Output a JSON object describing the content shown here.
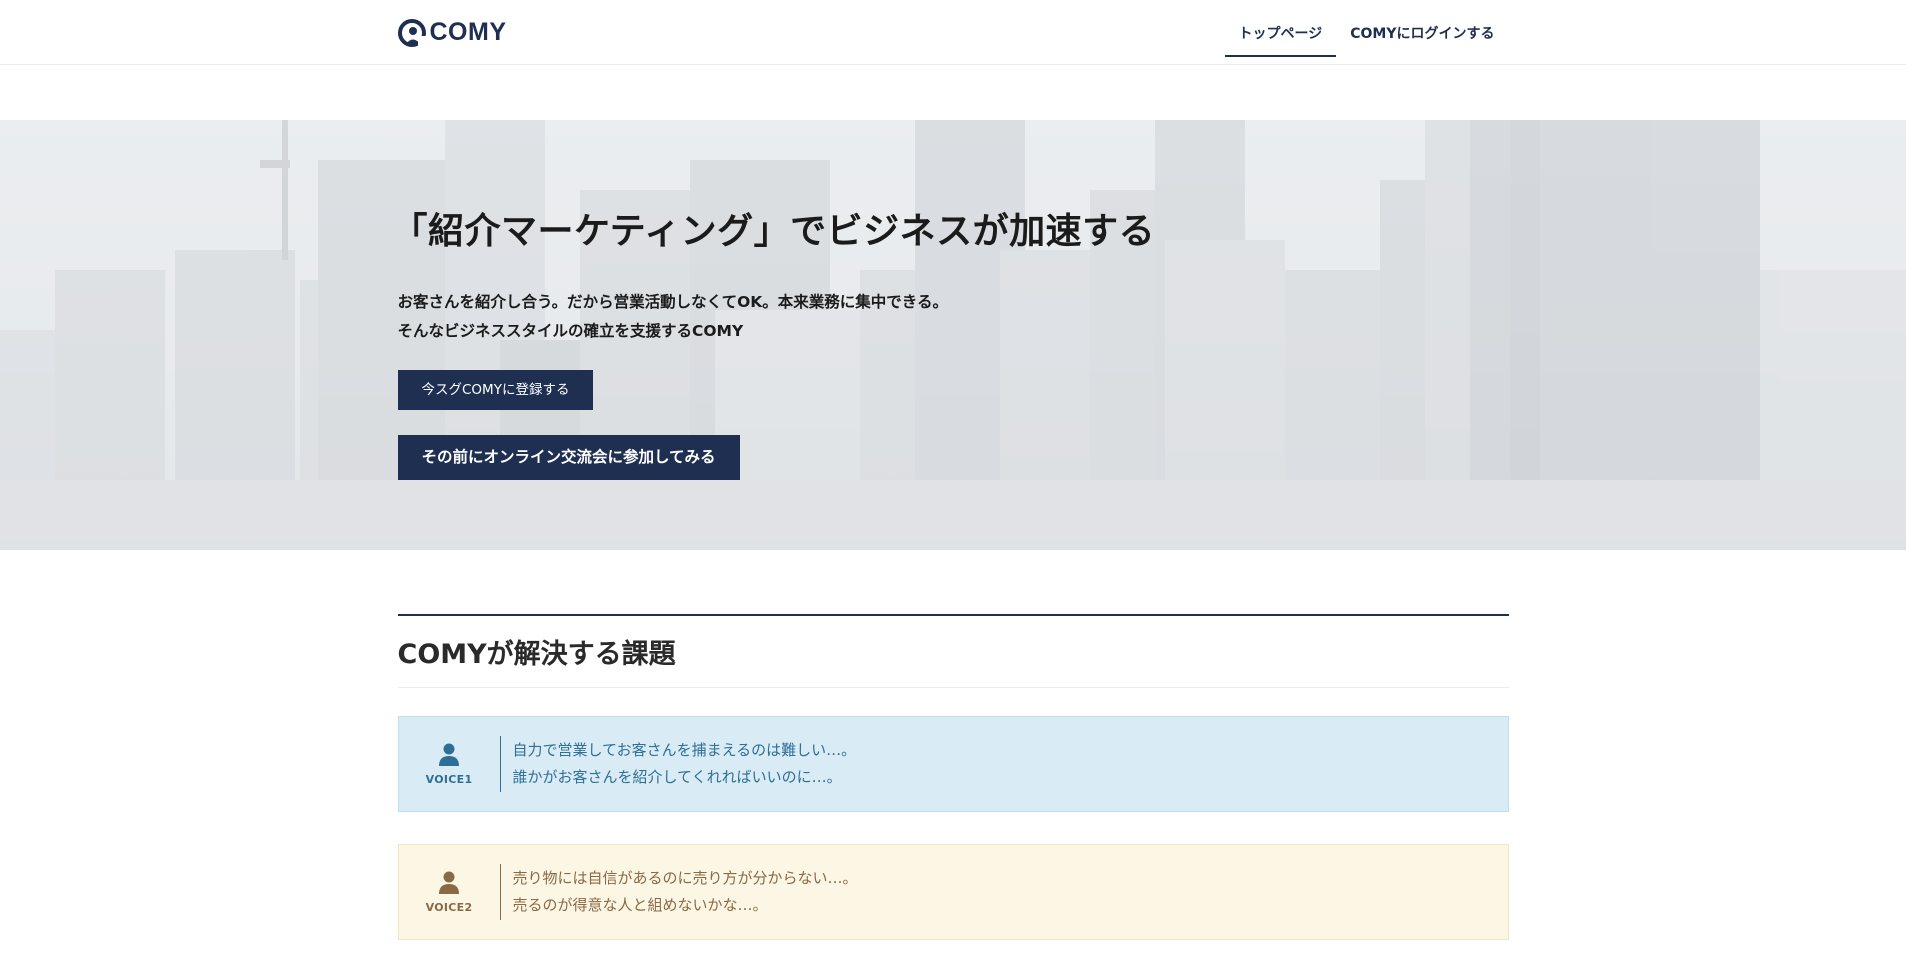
{
  "header": {
    "logo_text": "COMY",
    "nav": [
      {
        "label": "トップページ",
        "active": true
      },
      {
        "label": "COMYにログインする",
        "active": false
      }
    ]
  },
  "hero": {
    "title": "「紹介マーケティング」でビジネスが加速する",
    "lead_line1": "お客さんを紹介し合う。だから営業活動しなくてOK。本来業務に集中できる。",
    "lead_line2": "そんなビジネススタイルの確立を支援するCOMY",
    "register_button": "今スグCOMYに登録する",
    "event_button": "その前にオンライン交流会に参加してみる"
  },
  "section": {
    "title": "COMYが解決する課題",
    "voices": [
      {
        "label": "VOICE1",
        "line1": "自力で営業してお客さんを捕まえるのは難しい…。",
        "line2": "誰かがお客さんを紹介してくれればいいのに…。",
        "icon": "person-icon"
      },
      {
        "label": "VOICE2",
        "line1": "売り物には自信があるのに売り方が分からない…。",
        "line2": "売るのが得意な人と組めないかな…。",
        "icon": "person-icon"
      }
    ]
  },
  "colors": {
    "brand": "#1f2f52",
    "voice1_bg": "#d9ecf6",
    "voice1_text": "#2f6f95",
    "voice2_bg": "#fcf6e4",
    "voice2_text": "#8a6a45"
  }
}
